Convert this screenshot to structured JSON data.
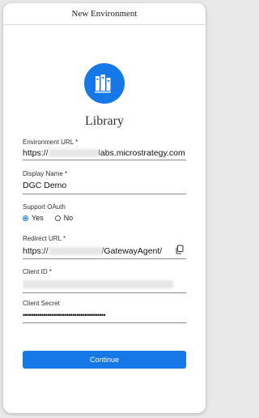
{
  "dialog": {
    "title": "New Environment",
    "app_name": "Library"
  },
  "fields": {
    "environment_url": {
      "label": "Environment URL *",
      "prefix": "https://",
      "suffix": "labs.microstrategy.com"
    },
    "display_name": {
      "label": "Display Name *",
      "value": "DGC Demo"
    },
    "support_oauth": {
      "label": "Support OAuth",
      "options": [
        "Yes",
        "No"
      ],
      "selected": "Yes"
    },
    "redirect_url": {
      "label": "Redirect URL *",
      "prefix": "https://",
      "suffix": "/GatewayAgent/"
    },
    "client_id": {
      "label": "Client ID *"
    },
    "client_secret": {
      "label": "Client Secret",
      "value": "••••••••••••••••••••••••••••••••••••••••"
    }
  },
  "actions": {
    "continue_label": "Continue"
  },
  "colors": {
    "accent": "#1677e6"
  },
  "icons": {
    "logo": "library-books-icon",
    "copy": "copy-icon"
  }
}
